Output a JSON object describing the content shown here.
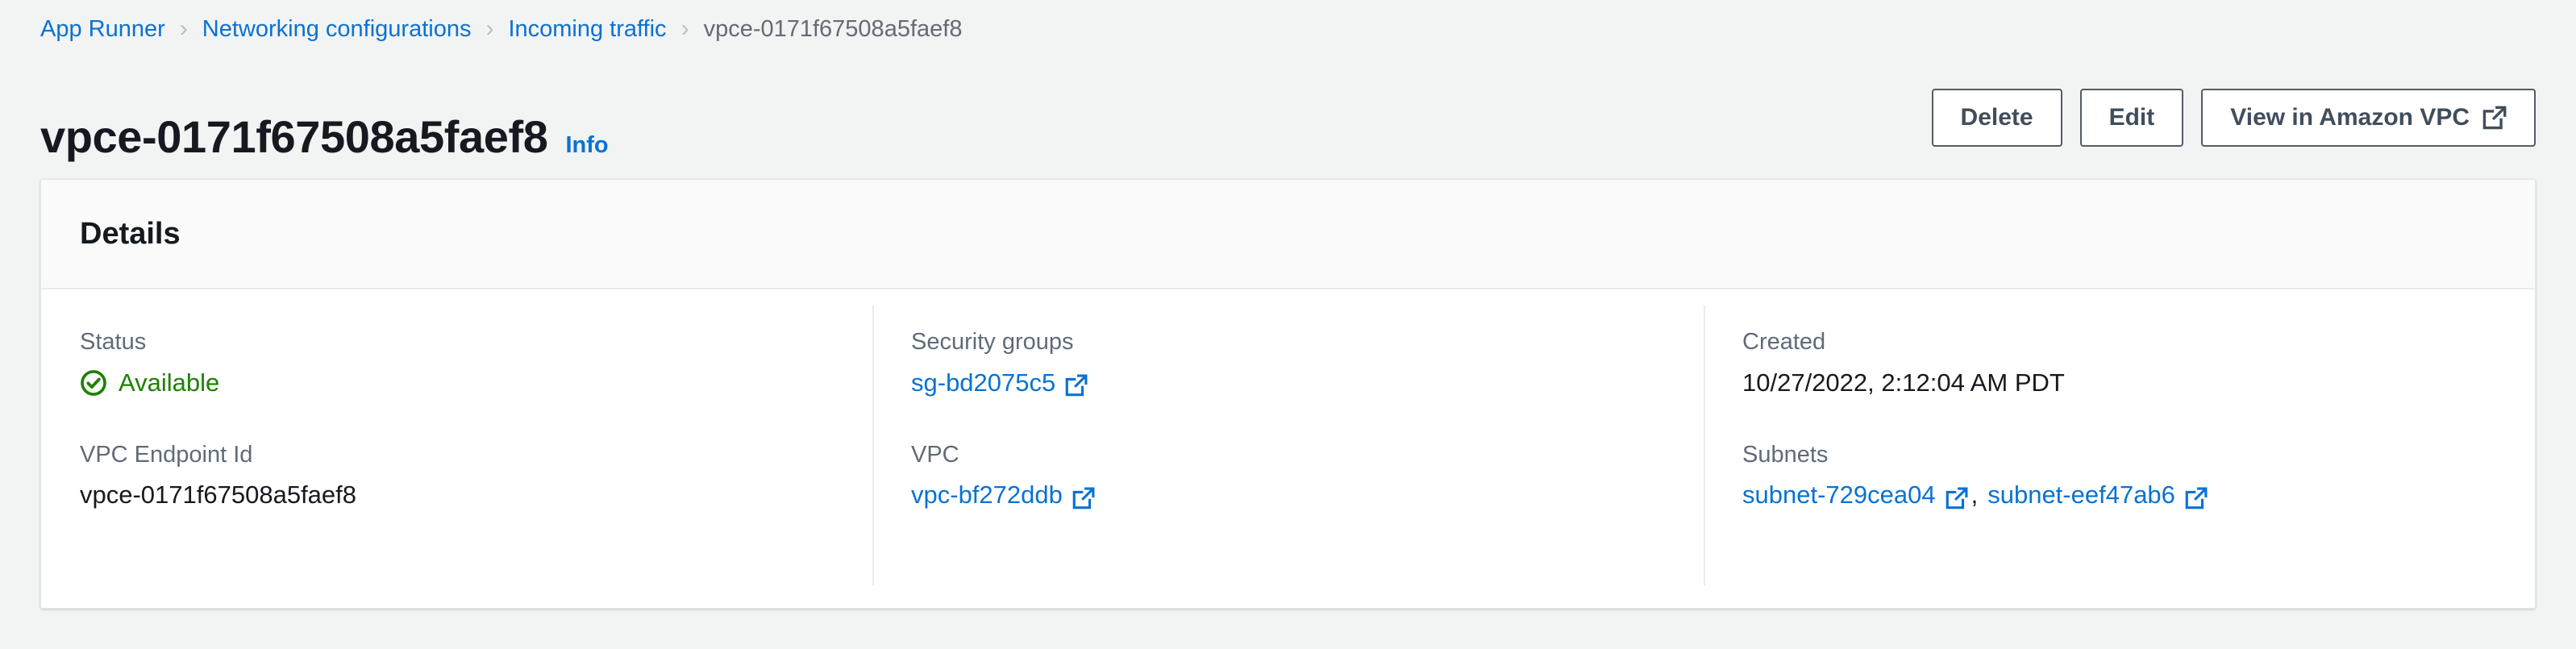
{
  "breadcrumb": {
    "items": [
      {
        "label": "App Runner",
        "current": false
      },
      {
        "label": "Networking configurations",
        "current": false
      },
      {
        "label": "Incoming traffic",
        "current": false
      },
      {
        "label": "vpce-0171f67508a5faef8",
        "current": true
      }
    ],
    "separator": "›"
  },
  "header": {
    "title": "vpce-0171f67508a5faef8",
    "info_label": "Info",
    "buttons": [
      {
        "label": "Delete",
        "external": false
      },
      {
        "label": "Edit",
        "external": false
      },
      {
        "label": "View in Amazon VPC",
        "external": true
      }
    ]
  },
  "details": {
    "panel_title": "Details",
    "columns": [
      {
        "fields": [
          {
            "label": "Status",
            "type": "status",
            "value": "Available",
            "icon": "check-circle-icon",
            "color": "#1d8102"
          },
          {
            "label": "VPC Endpoint Id",
            "type": "text",
            "value": "vpce-0171f67508a5faef8"
          }
        ]
      },
      {
        "fields": [
          {
            "label": "Security groups",
            "type": "links",
            "links": [
              {
                "text": "sg-bd2075c5",
                "external": true
              }
            ]
          },
          {
            "label": "VPC",
            "type": "links",
            "links": [
              {
                "text": "vpc-bf272ddb",
                "external": true
              }
            ]
          }
        ]
      },
      {
        "fields": [
          {
            "label": "Created",
            "type": "text",
            "value": "10/27/2022, 2:12:04 AM PDT"
          },
          {
            "label": "Subnets",
            "type": "links",
            "separator": ",",
            "links": [
              {
                "text": "subnet-729cea04",
                "external": true
              },
              {
                "text": "subnet-eef47ab6",
                "external": true
              }
            ]
          }
        ]
      }
    ]
  },
  "colors": {
    "link": "#0972d3",
    "status_success": "#1d8102",
    "text_primary": "#16191f",
    "text_secondary": "#5f6b7a",
    "page_background": "#f2f3f3",
    "panel_background": "#ffffff",
    "panel_header_background": "#fafafa",
    "button_border": "#545b64"
  }
}
